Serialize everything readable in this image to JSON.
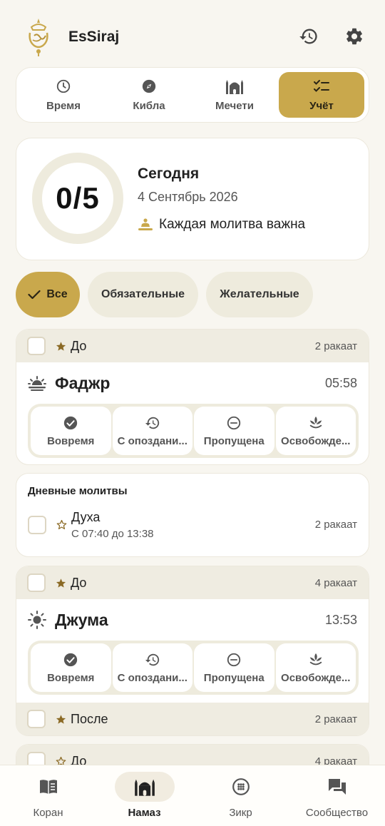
{
  "header": {
    "app_title": "EsSiraj",
    "logo_text": "السراج"
  },
  "tabs": [
    {
      "label": "Время",
      "icon": "clock-icon"
    },
    {
      "label": "Кибла",
      "icon": "compass-icon"
    },
    {
      "label": "Мечети",
      "icon": "mosque-icon"
    },
    {
      "label": "Учёт",
      "icon": "checklist-icon",
      "active": true
    }
  ],
  "summary": {
    "progress": "0/5",
    "completed": 0,
    "total": 5,
    "today_label": "Сегодня",
    "date": "4 Сентябрь 2026",
    "motto": "Каждая молитва важна"
  },
  "filters": [
    {
      "label": "Все",
      "active": true
    },
    {
      "label": "Обязательные"
    },
    {
      "label": "Желательные"
    }
  ],
  "status_labels": {
    "on_time": "Вовремя",
    "late": "С опоздани...",
    "missed": "Пропущена",
    "exempt": "Освобожде..."
  },
  "fajr": {
    "sunnah_before": {
      "label": "До",
      "rakaat": "2 ракаат"
    },
    "name": "Фаджр",
    "time": "05:58"
  },
  "daily": {
    "title": "Дневные молитвы",
    "duha": {
      "name": "Духа",
      "range": "С 07:40 до 13:38",
      "rakaat": "2 ракаат"
    }
  },
  "jumua": {
    "sunnah_before": {
      "label": "До",
      "rakaat": "4 ракаат"
    },
    "name": "Джума",
    "time": "13:53",
    "sunnah_after": {
      "label": "После",
      "rakaat": "2 ракаат"
    }
  },
  "next_card": {
    "sunnah_before": {
      "label": "До",
      "rakaat": "4 ракаат"
    }
  },
  "bottom_nav": [
    {
      "label": "Коран",
      "icon": "book-icon"
    },
    {
      "label": "Намаз",
      "icon": "mosque-icon",
      "active": true
    },
    {
      "label": "Зикр",
      "icon": "tasbih-icon"
    },
    {
      "label": "Сообщество",
      "icon": "chat-icon"
    }
  ],
  "colors": {
    "accent": "#c9a84c",
    "background": "#f8f6f0",
    "chip": "#eeebdd",
    "sunnah_row": "#efece1"
  }
}
